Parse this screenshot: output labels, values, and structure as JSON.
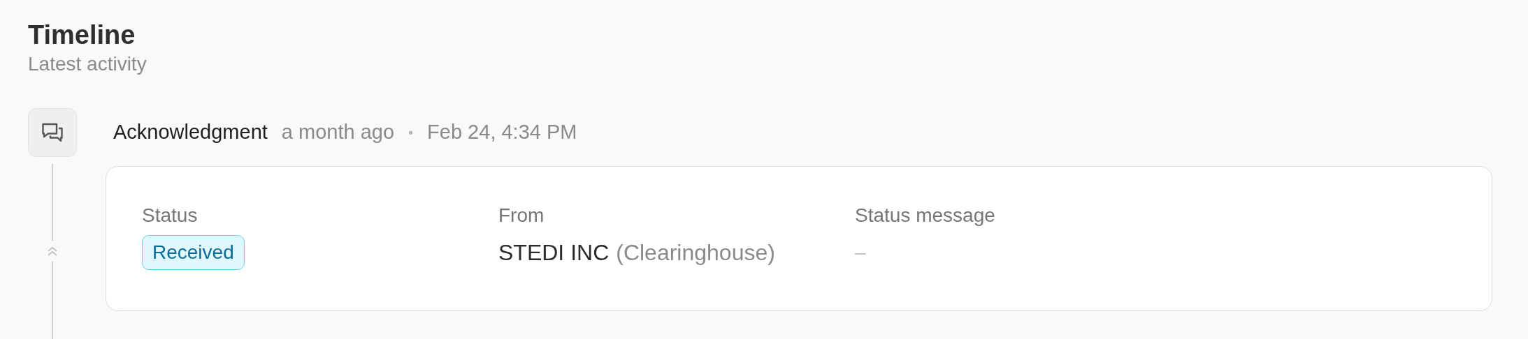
{
  "header": {
    "title": "Timeline",
    "subtitle": "Latest activity"
  },
  "events": [
    {
      "kind": "acknowledgment",
      "title": "Acknowledgment",
      "relative_time": "a month ago",
      "separator": "•",
      "timestamp": "Feb 24, 4:34 PM",
      "fields": [
        {
          "kind": "badge",
          "label": "Status",
          "value": "Received"
        },
        {
          "kind": "entity",
          "label": "From",
          "value": "STEDI INC",
          "note": "(Clearinghouse)"
        },
        {
          "kind": "text",
          "label": "Status message",
          "value": "–"
        }
      ]
    }
  ]
}
